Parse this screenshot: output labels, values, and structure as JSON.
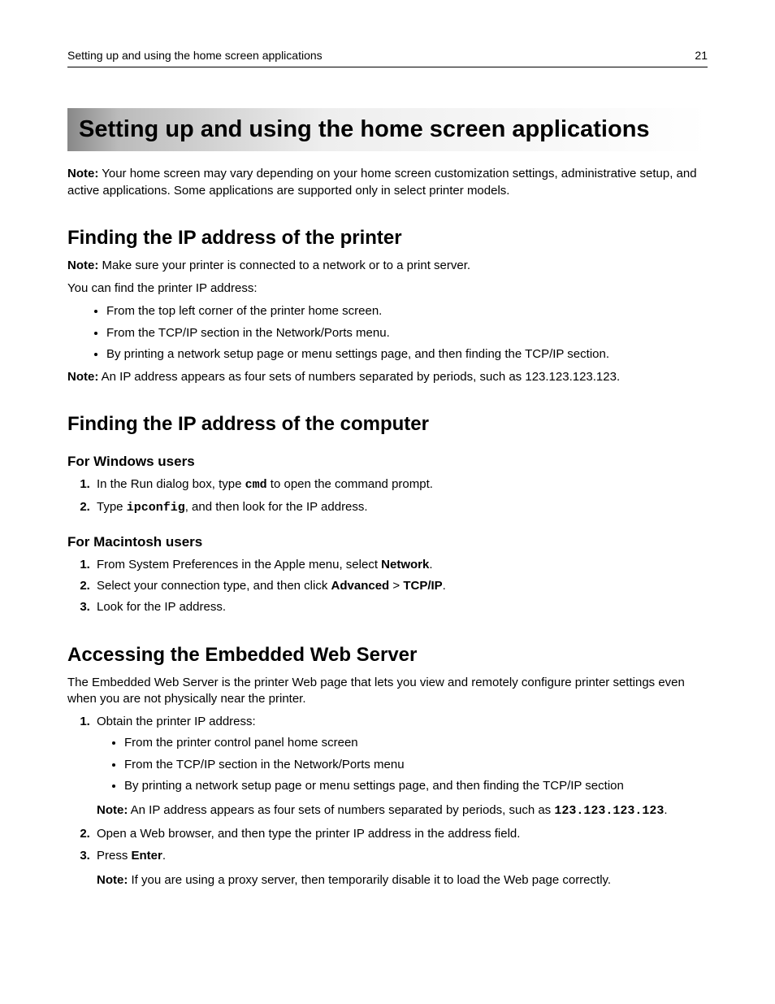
{
  "header": {
    "left": "Setting up and using the home screen applications",
    "right": "21"
  },
  "title": "Setting up and using the home screen applications",
  "intro": {
    "noteLabel": "Note:",
    "noteText": " Your home screen may vary depending on your home screen customization settings, administrative setup, and active applications. Some applications are supported only in select printer models."
  },
  "s1": {
    "heading": "Finding the IP address of the printer",
    "note1Label": "Note:",
    "note1Text": " Make sure your printer is connected to a network or to a print server.",
    "lead": "You can find the printer IP address:",
    "bullets": [
      "From the top left corner of the printer home screen.",
      "From the TCP/IP section in the Network/Ports menu.",
      "By printing a network setup page or menu settings page, and then finding the TCP/IP section."
    ],
    "note2Label": "Note:",
    "note2Text": " An IP address appears as four sets of numbers separated by periods, such as 123.123.123.123."
  },
  "s2": {
    "heading": "Finding the IP address of the computer",
    "win": {
      "heading": "For Windows users",
      "step1a": "In the Run dialog box, type ",
      "step1cmd": "cmd",
      "step1b": " to open the command prompt.",
      "step2a": "Type ",
      "step2cmd": "ipconfig",
      "step2b": ", and then look for the IP address."
    },
    "mac": {
      "heading": "For Macintosh users",
      "step1a": "From System Preferences in the Apple menu, select ",
      "step1b": "Network",
      "step1c": ".",
      "step2a": "Select your connection type, and then click ",
      "step2b": "Advanced",
      "step2gt": " > ",
      "step2c": "TCP/IP",
      "step2d": ".",
      "step3": "Look for the IP address."
    }
  },
  "s3": {
    "heading": "Accessing the Embedded Web Server",
    "para": "The Embedded Web Server is the printer Web page that lets you view and remotely configure printer settings even when you are not physically near the printer.",
    "step1": "Obtain the printer IP address:",
    "step1bullets": [
      "From the printer control panel home screen",
      "From the TCP/IP section in the Network/Ports menu",
      "By printing a network setup page or menu settings page, and then finding the TCP/IP section"
    ],
    "step1noteLabel": "Note:",
    "step1noteA": " An IP address appears as four sets of numbers separated by periods, such as ",
    "step1noteIP": "123.123.123.123",
    "step1noteB": ".",
    "step2": "Open a Web browser, and then type the printer IP address in the address field.",
    "step3a": "Press ",
    "step3b": "Enter",
    "step3c": ".",
    "step3noteLabel": "Note:",
    "step3noteText": " If you are using a proxy server, then temporarily disable it to load the Web page correctly."
  }
}
